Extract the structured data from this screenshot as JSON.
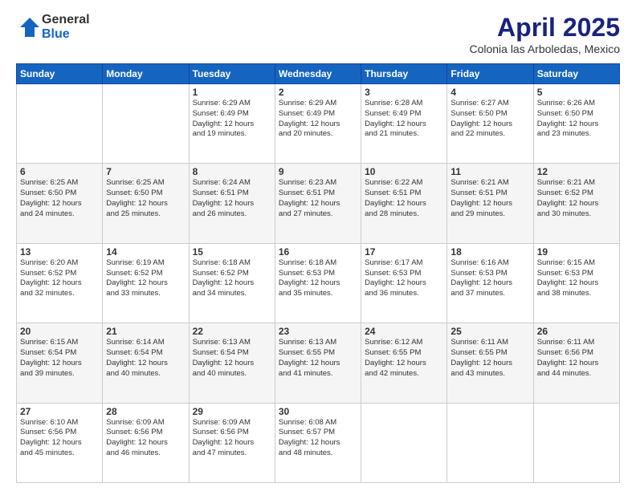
{
  "logo": {
    "general": "General",
    "blue": "Blue"
  },
  "title": "April 2025",
  "location": "Colonia las Arboledas, Mexico",
  "days": [
    "Sunday",
    "Monday",
    "Tuesday",
    "Wednesday",
    "Thursday",
    "Friday",
    "Saturday"
  ],
  "weeks": [
    [
      {
        "day": "",
        "info": ""
      },
      {
        "day": "",
        "info": ""
      },
      {
        "day": "1",
        "info": "Sunrise: 6:29 AM\nSunset: 6:49 PM\nDaylight: 12 hours\nand 19 minutes."
      },
      {
        "day": "2",
        "info": "Sunrise: 6:29 AM\nSunset: 6:49 PM\nDaylight: 12 hours\nand 20 minutes."
      },
      {
        "day": "3",
        "info": "Sunrise: 6:28 AM\nSunset: 6:49 PM\nDaylight: 12 hours\nand 21 minutes."
      },
      {
        "day": "4",
        "info": "Sunrise: 6:27 AM\nSunset: 6:50 PM\nDaylight: 12 hours\nand 22 minutes."
      },
      {
        "day": "5",
        "info": "Sunrise: 6:26 AM\nSunset: 6:50 PM\nDaylight: 12 hours\nand 23 minutes."
      }
    ],
    [
      {
        "day": "6",
        "info": "Sunrise: 6:25 AM\nSunset: 6:50 PM\nDaylight: 12 hours\nand 24 minutes."
      },
      {
        "day": "7",
        "info": "Sunrise: 6:25 AM\nSunset: 6:50 PM\nDaylight: 12 hours\nand 25 minutes."
      },
      {
        "day": "8",
        "info": "Sunrise: 6:24 AM\nSunset: 6:51 PM\nDaylight: 12 hours\nand 26 minutes."
      },
      {
        "day": "9",
        "info": "Sunrise: 6:23 AM\nSunset: 6:51 PM\nDaylight: 12 hours\nand 27 minutes."
      },
      {
        "day": "10",
        "info": "Sunrise: 6:22 AM\nSunset: 6:51 PM\nDaylight: 12 hours\nand 28 minutes."
      },
      {
        "day": "11",
        "info": "Sunrise: 6:21 AM\nSunset: 6:51 PM\nDaylight: 12 hours\nand 29 minutes."
      },
      {
        "day": "12",
        "info": "Sunrise: 6:21 AM\nSunset: 6:52 PM\nDaylight: 12 hours\nand 30 minutes."
      }
    ],
    [
      {
        "day": "13",
        "info": "Sunrise: 6:20 AM\nSunset: 6:52 PM\nDaylight: 12 hours\nand 32 minutes."
      },
      {
        "day": "14",
        "info": "Sunrise: 6:19 AM\nSunset: 6:52 PM\nDaylight: 12 hours\nand 33 minutes."
      },
      {
        "day": "15",
        "info": "Sunrise: 6:18 AM\nSunset: 6:52 PM\nDaylight: 12 hours\nand 34 minutes."
      },
      {
        "day": "16",
        "info": "Sunrise: 6:18 AM\nSunset: 6:53 PM\nDaylight: 12 hours\nand 35 minutes."
      },
      {
        "day": "17",
        "info": "Sunrise: 6:17 AM\nSunset: 6:53 PM\nDaylight: 12 hours\nand 36 minutes."
      },
      {
        "day": "18",
        "info": "Sunrise: 6:16 AM\nSunset: 6:53 PM\nDaylight: 12 hours\nand 37 minutes."
      },
      {
        "day": "19",
        "info": "Sunrise: 6:15 AM\nSunset: 6:53 PM\nDaylight: 12 hours\nand 38 minutes."
      }
    ],
    [
      {
        "day": "20",
        "info": "Sunrise: 6:15 AM\nSunset: 6:54 PM\nDaylight: 12 hours\nand 39 minutes."
      },
      {
        "day": "21",
        "info": "Sunrise: 6:14 AM\nSunset: 6:54 PM\nDaylight: 12 hours\nand 40 minutes."
      },
      {
        "day": "22",
        "info": "Sunrise: 6:13 AM\nSunset: 6:54 PM\nDaylight: 12 hours\nand 40 minutes."
      },
      {
        "day": "23",
        "info": "Sunrise: 6:13 AM\nSunset: 6:55 PM\nDaylight: 12 hours\nand 41 minutes."
      },
      {
        "day": "24",
        "info": "Sunrise: 6:12 AM\nSunset: 6:55 PM\nDaylight: 12 hours\nand 42 minutes."
      },
      {
        "day": "25",
        "info": "Sunrise: 6:11 AM\nSunset: 6:55 PM\nDaylight: 12 hours\nand 43 minutes."
      },
      {
        "day": "26",
        "info": "Sunrise: 6:11 AM\nSunset: 6:56 PM\nDaylight: 12 hours\nand 44 minutes."
      }
    ],
    [
      {
        "day": "27",
        "info": "Sunrise: 6:10 AM\nSunset: 6:56 PM\nDaylight: 12 hours\nand 45 minutes."
      },
      {
        "day": "28",
        "info": "Sunrise: 6:09 AM\nSunset: 6:56 PM\nDaylight: 12 hours\nand 46 minutes."
      },
      {
        "day": "29",
        "info": "Sunrise: 6:09 AM\nSunset: 6:56 PM\nDaylight: 12 hours\nand 47 minutes."
      },
      {
        "day": "30",
        "info": "Sunrise: 6:08 AM\nSunset: 6:57 PM\nDaylight: 12 hours\nand 48 minutes."
      },
      {
        "day": "",
        "info": ""
      },
      {
        "day": "",
        "info": ""
      },
      {
        "day": "",
        "info": ""
      }
    ]
  ]
}
